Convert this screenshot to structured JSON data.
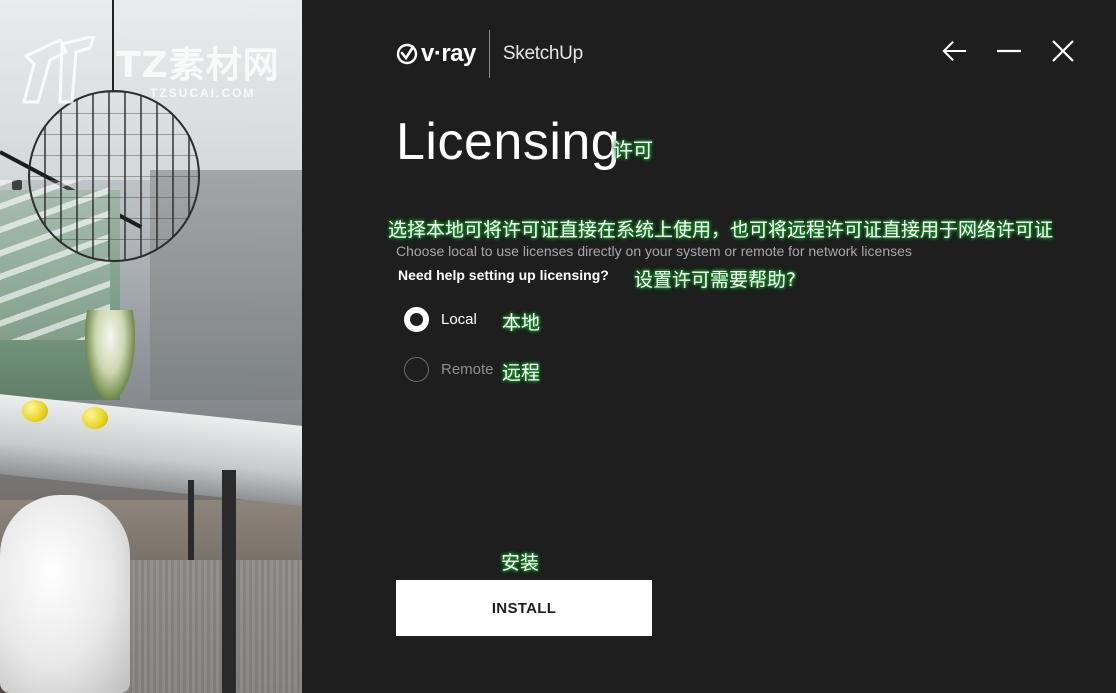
{
  "watermark": {
    "title": "TZ素材网",
    "subtitle": "TZSUCAI.COM",
    "logo_icon": "tz-logo-icon"
  },
  "brand": {
    "vray": "v·ray",
    "sketchup": "SketchUp"
  },
  "window_controls": {
    "back_icon": "arrow-left-icon",
    "minimize_icon": "minimize-icon",
    "close_icon": "close-icon"
  },
  "page": {
    "title": "Licensing",
    "title_zh": "许可",
    "description_zh": "选择本地可将许可证直接在系统上使用，也可将远程许可证直接用于网络许可证",
    "description": "Choose local to use licenses directly on your system or remote for network licenses",
    "help_link": "Need help setting up licensing?",
    "help_zh": "设置许可需要帮助?"
  },
  "options": [
    {
      "label": "Local",
      "label_zh": "本地",
      "selected": true
    },
    {
      "label": "Remote",
      "label_zh": "远程",
      "selected": false
    }
  ],
  "install": {
    "label": "INSTALL",
    "label_zh": "安装"
  },
  "colors": {
    "background": "#1e1e1e",
    "accent": "#ffffff",
    "muted_text": "#a8a8a8",
    "annotation_glow": "#1a8f2a"
  }
}
